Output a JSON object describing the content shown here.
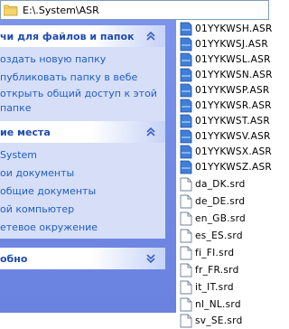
{
  "address": {
    "path": "E:\\.System\\ASR",
    "icon": "folder-icon"
  },
  "tasks_pane": {
    "file_tasks": {
      "title": "чи для файлов и папок",
      "chevron": "collapse-chevron-icon",
      "links": [
        "оздать новую папку",
        "публиковать папку в вебе",
        "открыть общий доступ к этой",
        "папке"
      ]
    },
    "other_places": {
      "title": "ие места",
      "chevron": "collapse-chevron-icon",
      "links": [
        "System",
        "ои документы",
        "общие документы",
        "ой компьютер",
        "етевое окружение"
      ]
    },
    "details": {
      "title": "обно",
      "chevron": "expand-chevron-icon"
    }
  },
  "files": [
    {
      "name": "01YYKWSH.ASR",
      "icon": "asr-file-icon"
    },
    {
      "name": "01YYKWSJ.ASR",
      "icon": "asr-file-icon"
    },
    {
      "name": "01YYKWSL.ASR",
      "icon": "asr-file-icon"
    },
    {
      "name": "01YYKWSN.ASR",
      "icon": "asr-file-icon"
    },
    {
      "name": "01YYKWSP.ASR",
      "icon": "asr-file-icon"
    },
    {
      "name": "01YYKWSR.ASR",
      "icon": "asr-file-icon"
    },
    {
      "name": "01YYKWST.ASR",
      "icon": "asr-file-icon"
    },
    {
      "name": "01YYKWSV.ASR",
      "icon": "asr-file-icon"
    },
    {
      "name": "01YYKWSX.ASR",
      "icon": "asr-file-icon"
    },
    {
      "name": "01YYKWSZ.ASR",
      "icon": "asr-file-icon"
    },
    {
      "name": "da_DK.srd",
      "icon": "srd-file-icon"
    },
    {
      "name": "de_DE.srd",
      "icon": "srd-file-icon"
    },
    {
      "name": "en_GB.srd",
      "icon": "srd-file-icon"
    },
    {
      "name": "es_ES.srd",
      "icon": "srd-file-icon"
    },
    {
      "name": "fi_FI.srd",
      "icon": "srd-file-icon"
    },
    {
      "name": "fr_FR.srd",
      "icon": "srd-file-icon"
    },
    {
      "name": "it_IT.srd",
      "icon": "srd-file-icon"
    },
    {
      "name": "nl_NL.srd",
      "icon": "srd-file-icon"
    },
    {
      "name": "sv_SE.srd",
      "icon": "srd-file-icon"
    }
  ]
}
